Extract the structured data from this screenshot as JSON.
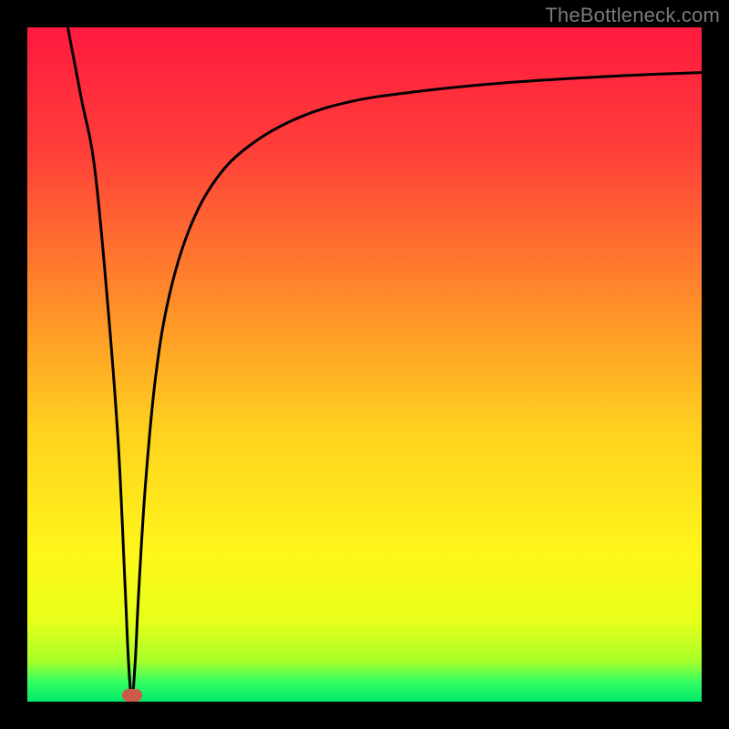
{
  "watermark": {
    "text": "TheBottleneck.com"
  },
  "gradient": {
    "stops": [
      {
        "at": 0,
        "color": "#ff1a3f"
      },
      {
        "at": 18,
        "color": "#ff3e3a"
      },
      {
        "at": 40,
        "color": "#ff8a2a"
      },
      {
        "at": 60,
        "color": "#ffd21f"
      },
      {
        "at": 78,
        "color": "#fff61a"
      },
      {
        "at": 88,
        "color": "#e7ff1a"
      },
      {
        "at": 94,
        "color": "#a8ff2a"
      },
      {
        "at": 97,
        "color": "#37ff62"
      },
      {
        "at": 100,
        "color": "#00e96b"
      }
    ]
  },
  "curve": {
    "stroke": "#000000",
    "width": 3
  },
  "marker": {
    "x_pct": 15.5,
    "y_pct": 99.0,
    "color": "#cc5a4a"
  },
  "chart_data": {
    "type": "line",
    "title": "",
    "xlabel": "",
    "ylabel": "",
    "xlim": [
      0,
      100
    ],
    "ylim": [
      0,
      100
    ],
    "note": "x and y are percentages of the plot area (0 = left/bottom edge within the colored panel, 100 = right/top edge). Curve value is bottleneck-like magnitude; dips to ~0 near x≈15.5 then rises asymptotically toward ~93.",
    "series": [
      {
        "name": "curve",
        "x": [
          6.0,
          8.0,
          10.0,
          12.0,
          13.5,
          14.5,
          15.0,
          15.5,
          16.0,
          16.5,
          17.5,
          19.0,
          21.0,
          24.0,
          28.0,
          33.0,
          40.0,
          48.0,
          58.0,
          70.0,
          82.0,
          92.0,
          100.0
        ],
        "values": [
          100,
          89.5,
          79.0,
          58.0,
          38.0,
          17.0,
          6.0,
          0.5,
          6.0,
          16.0,
          32.0,
          48.0,
          60.0,
          70.0,
          77.5,
          82.5,
          86.5,
          89.0,
          90.5,
          91.7,
          92.5,
          93.0,
          93.3
        ]
      }
    ],
    "marker_point": {
      "x": 15.5,
      "y": 1.0
    }
  }
}
